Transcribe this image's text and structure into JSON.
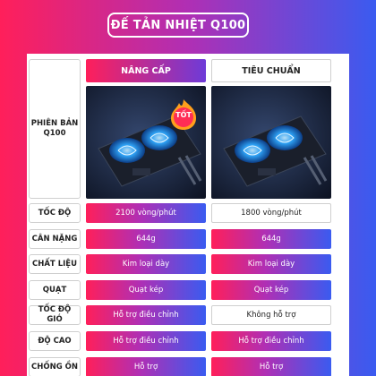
{
  "header": {
    "title": "ĐẾ TẢN NHIỆT Q100"
  },
  "columns": {
    "upgrade": "NÂNG CẤP",
    "standard": "TIÊU CHUẨN"
  },
  "version_label": "PHIÊN BẢN\nQ100",
  "badge": "TỐT",
  "rows": [
    {
      "label": "TỐC ĐỘ",
      "upgrade": "2100 vòng/phút",
      "standard": "1800 vòng/phút"
    },
    {
      "label": "CÂN NẶNG",
      "upgrade": "644g",
      "standard": "644g"
    },
    {
      "label": "CHẤT LIỆU",
      "upgrade": "Kim loại dày",
      "standard": "Kim loại dày"
    },
    {
      "label": "QUẠT",
      "upgrade": "Quạt kép",
      "standard": "Quạt kép"
    },
    {
      "label": "TỐC ĐỘ GIÓ",
      "upgrade": "Hỗ trợ điều chỉnh",
      "standard": "Không hỗ trợ"
    },
    {
      "label": "ĐỘ CAO",
      "upgrade": "Hỗ trợ điều chỉnh",
      "standard": "Hỗ trợ điều chỉnh"
    },
    {
      "label": "CHỐNG ỒN",
      "upgrade": "Hỗ trợ",
      "standard": "Hỗ trợ"
    }
  ],
  "row_styles": [
    {
      "upgrade": "grad",
      "standard": "plain"
    },
    {
      "upgrade": "grad",
      "standard": "grad"
    },
    {
      "upgrade": "grad",
      "standard": "grad"
    },
    {
      "upgrade": "grad",
      "standard": "grad"
    },
    {
      "upgrade": "grad",
      "standard": "plain"
    },
    {
      "upgrade": "grad",
      "standard": "grad"
    },
    {
      "upgrade": "grad",
      "standard": "grad"
    }
  ],
  "icons": {
    "product_upgrade": "cooling-pad-image",
    "product_standard": "cooling-pad-image",
    "badge": "flame-badge-icon"
  },
  "colors": {
    "gradient_start": "#ff1f5a",
    "gradient_mid": "#b02fb4",
    "gradient_end": "#3a5bf0",
    "fan_glow": "#2fa8ff"
  }
}
